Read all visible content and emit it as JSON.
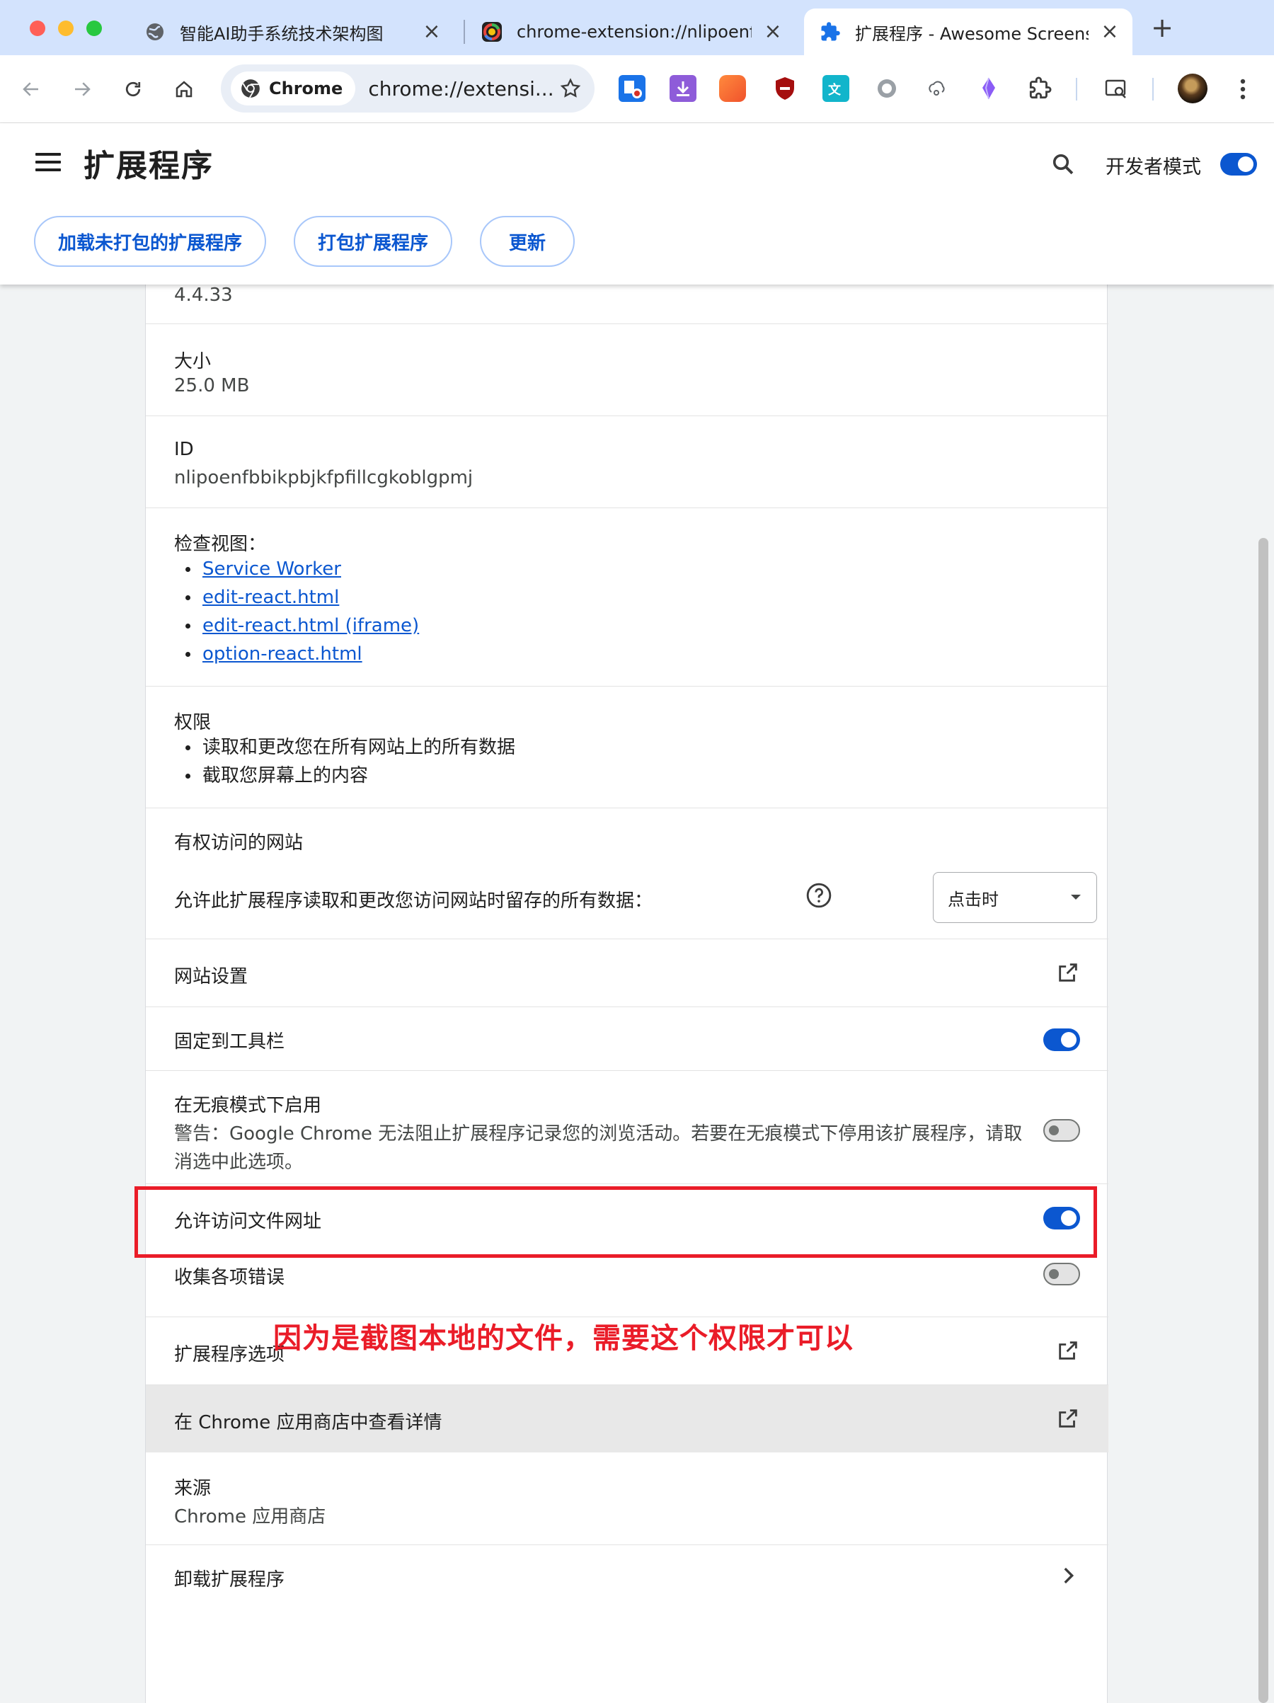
{
  "tabs": [
    {
      "title": "智能AI助手系统技术架构图",
      "active": false
    },
    {
      "title": "chrome-extension://nlipoenfb",
      "active": false
    },
    {
      "title": "扩展程序 - Awesome Screensh",
      "active": true
    }
  ],
  "toolbar": {
    "chip_label": "Chrome",
    "url": "chrome://extensi..."
  },
  "header": {
    "title": "扩展程序",
    "dev_mode_label": "开发者模式",
    "dev_mode_on": true,
    "buttons": {
      "load_unpacked": "加载未打包的扩展程序",
      "pack": "打包扩展程序",
      "update": "更新"
    }
  },
  "details": {
    "version": "4.4.33",
    "size_label": "大小",
    "size_value": "25.0 MB",
    "id_label": "ID",
    "id_value": "nlipoenfbbikpbjkfpfillcgkoblgpmj",
    "inspect_label": "检查视图：",
    "inspect_views": [
      "Service Worker",
      "edit-react.html",
      "edit-react.html (iframe)",
      "option-react.html"
    ],
    "permissions_label": "权限",
    "permissions": [
      "读取和更改您在所有网站上的所有数据",
      "截取您屏幕上的内容"
    ],
    "site_access_label": "有权访问的网站",
    "site_access_desc": "允许此扩展程序读取和更改您访问网站时留存的所有数据：",
    "site_access_value": "点击时",
    "site_settings_label": "网站设置",
    "pin_label": "固定到工具栏",
    "pin_on": true,
    "incognito_label": "在无痕模式下启用",
    "incognito_warning_line1": "警告：Google Chrome 无法阻止扩展程序记录您的浏览活动。若要在无痕模式下停用该扩展程序，请取",
    "incognito_warning_line2": "消选中此选项。",
    "incognito_on": false,
    "file_urls_label": "允许访问文件网址",
    "file_urls_on": true,
    "collect_errors_label": "收集各项错误",
    "collect_errors_on": false,
    "options_label": "扩展程序选项",
    "store_label": "在 Chrome 应用商店中查看详情",
    "source_label": "来源",
    "source_value": "Chrome 应用商店",
    "remove_label": "卸载扩展程序"
  },
  "annotation": {
    "text": "因为是截图本地的文件，需要这个权限才可以",
    "color": "#ea1c28"
  },
  "colors": {
    "accent": "#0b57d0",
    "tabstrip": "#d3e3fd"
  }
}
